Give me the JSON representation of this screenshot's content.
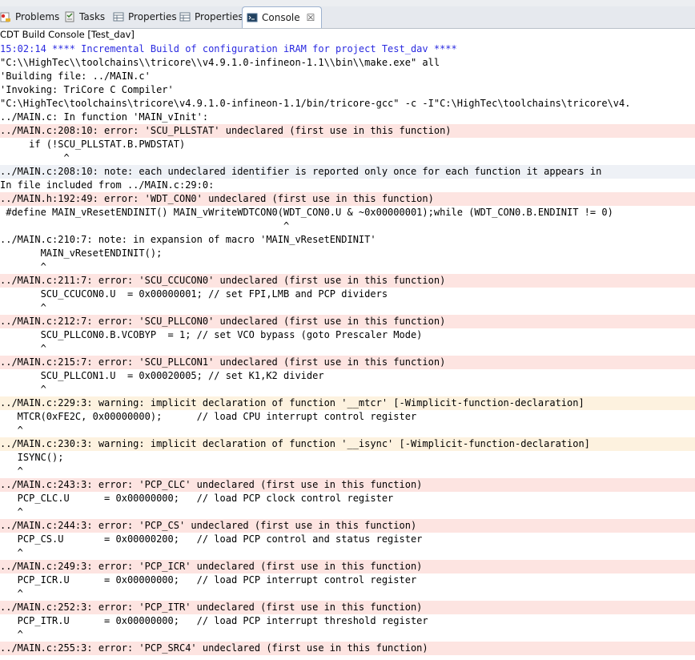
{
  "tabs": [
    {
      "label": "Problems",
      "icon": "problems-icon",
      "active": false
    },
    {
      "label": "Tasks",
      "icon": "tasks-icon",
      "active": false
    },
    {
      "label": "Properties",
      "icon": "properties-icon",
      "active": false
    },
    {
      "label": "Properties",
      "icon": "properties-icon",
      "active": false
    },
    {
      "label": "Console",
      "icon": "console-icon",
      "active": true,
      "close": "☒"
    }
  ],
  "console_title": "CDT Build Console [Test_dav]",
  "colors": {
    "error_bg": "#fde4e1",
    "warning_bg": "#fdf2df",
    "note_bg": "#eef1f6",
    "header_text": "#2a2ae0"
  },
  "lines": [
    {
      "text": "15:02:14 **** Incremental Build of configuration iRAM for project Test_dav ****",
      "kind": "head"
    },
    {
      "text": "\"C:\\\\HighTec\\\\toolchains\\\\tricore\\\\v4.9.1.0-infineon-1.1\\\\bin\\\\make.exe\" all",
      "kind": "plain"
    },
    {
      "text": "'Building file: ../MAIN.c'",
      "kind": "plain"
    },
    {
      "text": "'Invoking: TriCore C Compiler'",
      "kind": "plain"
    },
    {
      "text": "\"C:\\HighTec\\toolchains\\tricore\\v4.9.1.0-infineon-1.1/bin/tricore-gcc\" -c -I\"C:\\HighTec\\toolchains\\tricore\\v4.",
      "kind": "plain"
    },
    {
      "text": "../MAIN.c: In function 'MAIN_vInit':",
      "kind": "plain"
    },
    {
      "text": "../MAIN.c:208:10: error: 'SCU_PLLSTAT' undeclared (first use in this function)",
      "kind": "err"
    },
    {
      "text": "     if (!SCU_PLLSTAT.B.PWDSTAT)",
      "kind": "plain"
    },
    {
      "text": "           ^",
      "kind": "plain"
    },
    {
      "text": "../MAIN.c:208:10: note: each undeclared identifier is reported only once for each function it appears in",
      "kind": "note"
    },
    {
      "text": "In file included from ../MAIN.c:29:0:",
      "kind": "plain"
    },
    {
      "text": "../MAIN.h:192:49: error: 'WDT_CON0' undeclared (first use in this function)",
      "kind": "err"
    },
    {
      "text": " #define MAIN_vResetENDINIT() MAIN_vWriteWDTCON0(WDT_CON0.U & ~0x00000001);while (WDT_CON0.B.ENDINIT != 0)",
      "kind": "plain"
    },
    {
      "text": "                                                 ^",
      "kind": "plain"
    },
    {
      "text": "../MAIN.c:210:7: note: in expansion of macro 'MAIN_vResetENDINIT'",
      "kind": "plain"
    },
    {
      "text": "       MAIN_vResetENDINIT();",
      "kind": "plain"
    },
    {
      "text": "       ^",
      "kind": "plain"
    },
    {
      "text": "../MAIN.c:211:7: error: 'SCU_CCUCON0' undeclared (first use in this function)",
      "kind": "err"
    },
    {
      "text": "       SCU_CCUCON0.U  = 0x00000001; // set FPI,LMB and PCP dividers",
      "kind": "plain"
    },
    {
      "text": "       ^",
      "kind": "plain"
    },
    {
      "text": "../MAIN.c:212:7: error: 'SCU_PLLCON0' undeclared (first use in this function)",
      "kind": "err"
    },
    {
      "text": "       SCU_PLLCON0.B.VCOBYP  = 1; // set VCO bypass (goto Prescaler Mode)",
      "kind": "plain"
    },
    {
      "text": "       ^",
      "kind": "plain"
    },
    {
      "text": "../MAIN.c:215:7: error: 'SCU_PLLCON1' undeclared (first use in this function)",
      "kind": "err"
    },
    {
      "text": "       SCU_PLLCON1.U  = 0x00020005; // set K1,K2 divider",
      "kind": "plain"
    },
    {
      "text": "       ^",
      "kind": "plain"
    },
    {
      "text": "../MAIN.c:229:3: warning: implicit declaration of function '__mtcr' [-Wimplicit-function-declaration]",
      "kind": "warn"
    },
    {
      "text": "   MTCR(0xFE2C, 0x00000000);      // load CPU interrupt control register",
      "kind": "plain"
    },
    {
      "text": "   ^",
      "kind": "plain"
    },
    {
      "text": "../MAIN.c:230:3: warning: implicit declaration of function '__isync' [-Wimplicit-function-declaration]",
      "kind": "warn"
    },
    {
      "text": "   ISYNC();",
      "kind": "plain"
    },
    {
      "text": "   ^",
      "kind": "plain"
    },
    {
      "text": "../MAIN.c:243:3: error: 'PCP_CLC' undeclared (first use in this function)",
      "kind": "err"
    },
    {
      "text": "   PCP_CLC.U      = 0x00000000;   // load PCP clock control register",
      "kind": "plain"
    },
    {
      "text": "   ^",
      "kind": "plain"
    },
    {
      "text": "../MAIN.c:244:3: error: 'PCP_CS' undeclared (first use in this function)",
      "kind": "err"
    },
    {
      "text": "   PCP_CS.U       = 0x00000200;   // load PCP control and status register",
      "kind": "plain"
    },
    {
      "text": "   ^",
      "kind": "plain"
    },
    {
      "text": "../MAIN.c:249:3: error: 'PCP_ICR' undeclared (first use in this function)",
      "kind": "err"
    },
    {
      "text": "   PCP_ICR.U      = 0x00000000;   // load PCP interrupt control register",
      "kind": "plain"
    },
    {
      "text": "   ^",
      "kind": "plain"
    },
    {
      "text": "../MAIN.c:252:3: error: 'PCP_ITR' undeclared (first use in this function)",
      "kind": "err"
    },
    {
      "text": "   PCP_ITR.U      = 0x00000000;   // load PCP interrupt threshold register",
      "kind": "plain"
    },
    {
      "text": "   ^",
      "kind": "plain"
    },
    {
      "text": "../MAIN.c:255:3: error: 'PCP_SRC4' undeclared (first use in this function)",
      "kind": "err"
    }
  ]
}
